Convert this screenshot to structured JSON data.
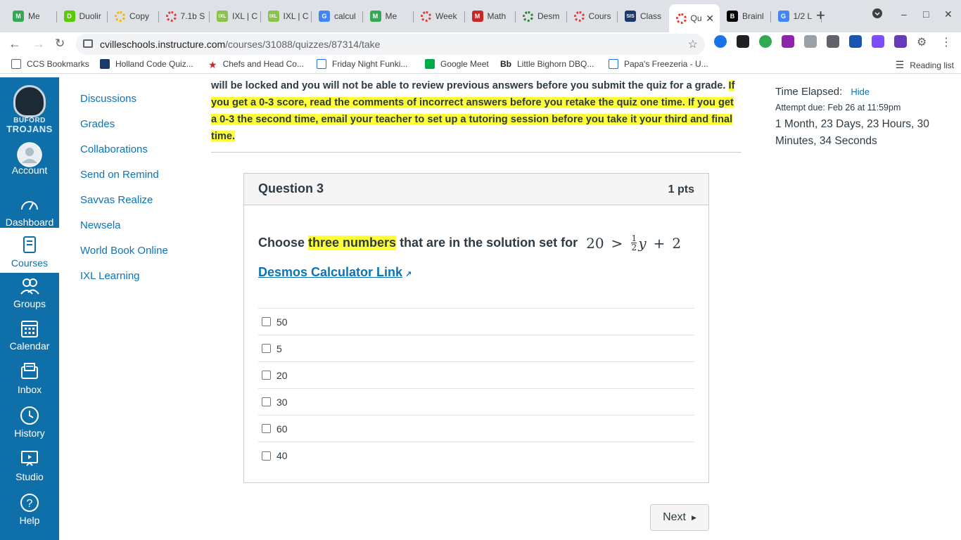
{
  "browser": {
    "tabs": [
      {
        "label": "Me",
        "color": "#34a853",
        "letter": "M"
      },
      {
        "label": "Duolir",
        "color": "#58cc02",
        "letter": "D"
      },
      {
        "label": "Copy",
        "color": "#f4b400",
        "letter": ""
      },
      {
        "label": "7.1b S",
        "color": "#e53935",
        "letter": ""
      },
      {
        "label": "IXL | C",
        "color": "#8bc34a",
        "letter": "IXL"
      },
      {
        "label": "IXL | C",
        "color": "#8bc34a",
        "letter": "IXL"
      },
      {
        "label": "calcul",
        "color": "#4285f4",
        "letter": "G"
      },
      {
        "label": "Me",
        "color": "#34a853",
        "letter": "M"
      },
      {
        "label": "Week",
        "color": "#e53935",
        "letter": ""
      },
      {
        "label": "Math",
        "color": "#c62828",
        "letter": "M"
      },
      {
        "label": "Desm",
        "color": "#2e7d32",
        "letter": ""
      },
      {
        "label": "Cours",
        "color": "#e53935",
        "letter": ""
      },
      {
        "label": "Class",
        "color": "#1a3a6b",
        "letter": "SIS"
      },
      {
        "label": "Qu",
        "color": "#e53935",
        "letter": ""
      },
      {
        "label": "Brainl",
        "color": "#000000",
        "letter": "B"
      },
      {
        "label": "1/2 L",
        "color": "#4285f4",
        "letter": "G"
      }
    ],
    "url_host": "cvilleschools.instructure.com",
    "url_path": "/courses/31088/quizzes/87314/take",
    "bookmarks": [
      "CCS Bookmarks",
      "Holland Code Quiz...",
      "Chefs and Head Co...",
      "Friday Night Funki...",
      "Google Meet",
      "Little Bighorn DBQ...",
      "Papa's Freezeria - U..."
    ],
    "bookmark_bb": "Bb",
    "reading_list": "Reading list"
  },
  "logo_text": [
    "BUFORD",
    "TROJANS"
  ],
  "global_nav": [
    {
      "label": "Account",
      "icon": "account-icon"
    },
    {
      "label": "Dashboard",
      "icon": "dashboard-icon"
    },
    {
      "label": "Courses",
      "icon": "courses-icon"
    },
    {
      "label": "Groups",
      "icon": "groups-icon"
    },
    {
      "label": "Calendar",
      "icon": "calendar-icon"
    },
    {
      "label": "Inbox",
      "icon": "inbox-icon"
    },
    {
      "label": "History",
      "icon": "history-icon"
    },
    {
      "label": "Studio",
      "icon": "studio-icon"
    },
    {
      "label": "Help",
      "icon": "help-icon"
    }
  ],
  "course_nav": [
    "Discussions",
    "Grades",
    "Collaborations",
    "Send on Remind",
    "Savvas Realize",
    "Newsela",
    "World Book Online",
    "IXL Learning"
  ],
  "instructions": {
    "line1": "will be locked and you will not be able to review previous answers before you submit the quiz for a grade.",
    "highlight": "If you get a 0-3 score, read the comments of incorrect answers before you retake the quiz one time. If you get a 0-3 the second time, email your teacher to set up a tutoring session before you take it your third and final time."
  },
  "question": {
    "title": "Question 3",
    "points": "1 pts",
    "text_before": "Choose ",
    "text_highlight": "three numbers",
    "text_after": " that are in the solution set for",
    "math_left": "20",
    "math_op": ">",
    "frac_num": "1",
    "frac_den": "2",
    "math_var": "y",
    "math_plus": "+",
    "math_right": "2",
    "link_text": "Desmos Calculator Link",
    "answers": [
      "50",
      "5",
      "20",
      "30",
      "60",
      "40"
    ]
  },
  "next_label": "Next",
  "timer": {
    "label": "Time Elapsed:",
    "hide": "Hide",
    "due": "Attempt due: Feb 26 at 11:59pm",
    "elapsed": "1 Month, 23 Days, 23 Hours, 30 Minutes, 34 Seconds"
  },
  "colors": {
    "canvas_nav": "#0f6fa8",
    "link": "#0b74b9",
    "highlight": "#ffff37"
  }
}
